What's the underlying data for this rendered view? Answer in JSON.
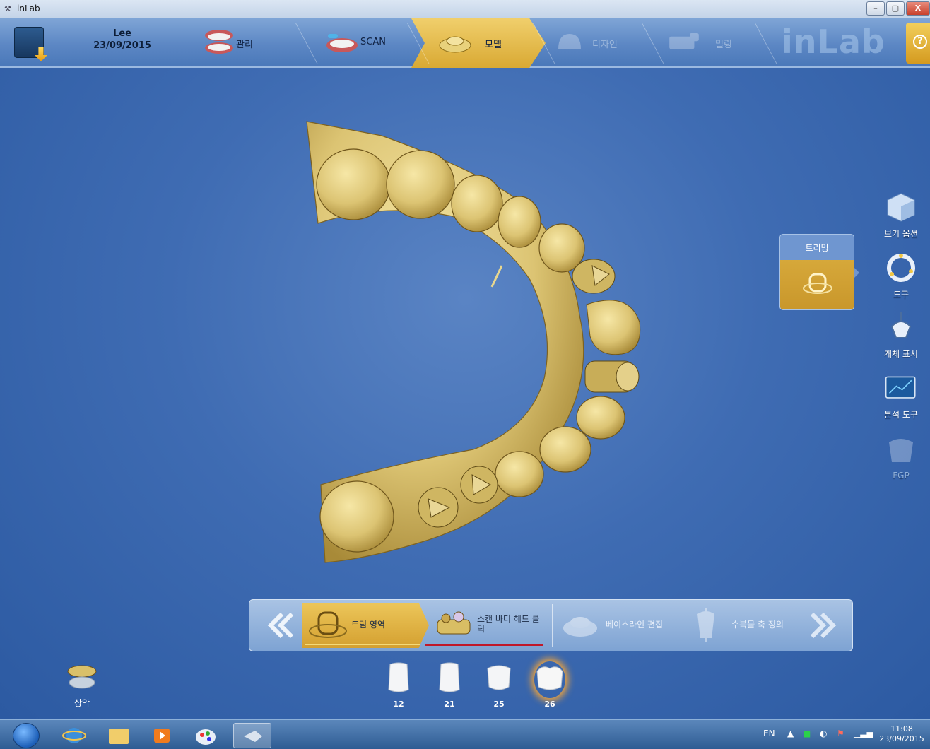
{
  "window": {
    "title": "inLab",
    "minimize_label": "–",
    "maximize_label": "▢",
    "close_label": "X"
  },
  "patient": {
    "name": "Lee",
    "date": "23/09/2015"
  },
  "workflow": {
    "steps": [
      {
        "label": "관리",
        "state": "done"
      },
      {
        "label": "SCAN",
        "state": "done"
      },
      {
        "label": "모델",
        "state": "active"
      },
      {
        "label": "디자인",
        "state": "disabled"
      },
      {
        "label": "밀링",
        "state": "disabled"
      }
    ],
    "logo": "inLab"
  },
  "help": {
    "label": "?"
  },
  "right_tools": {
    "view_options": "보기 옵션",
    "tools": "도구",
    "object_display": "개체 표시",
    "analysis_tools": "분석 도구",
    "fgp": "FGP"
  },
  "trim_panel": {
    "title": "트리밍"
  },
  "step_bar": {
    "steps": [
      {
        "label": "트림 영역",
        "state": "active"
      },
      {
        "label": "스캔 바디 헤드 클릭",
        "state": "current"
      },
      {
        "label": "베이스라인 편집",
        "state": "disabled"
      },
      {
        "label": "수복물 축 정의",
        "state": "disabled"
      }
    ]
  },
  "jaw": {
    "label": "상악"
  },
  "teeth": [
    {
      "number": "12",
      "selected": false
    },
    {
      "number": "21",
      "selected": false
    },
    {
      "number": "25",
      "selected": false
    },
    {
      "number": "26",
      "selected": true
    }
  ],
  "taskbar": {
    "language": "EN",
    "time": "11:08",
    "date": "23/09/2015"
  },
  "colors": {
    "accent_gold": "#d9a933",
    "background_blue": "#3f6cb3",
    "model_gold": "#e3cf83",
    "underline_red": "#c0182a"
  }
}
